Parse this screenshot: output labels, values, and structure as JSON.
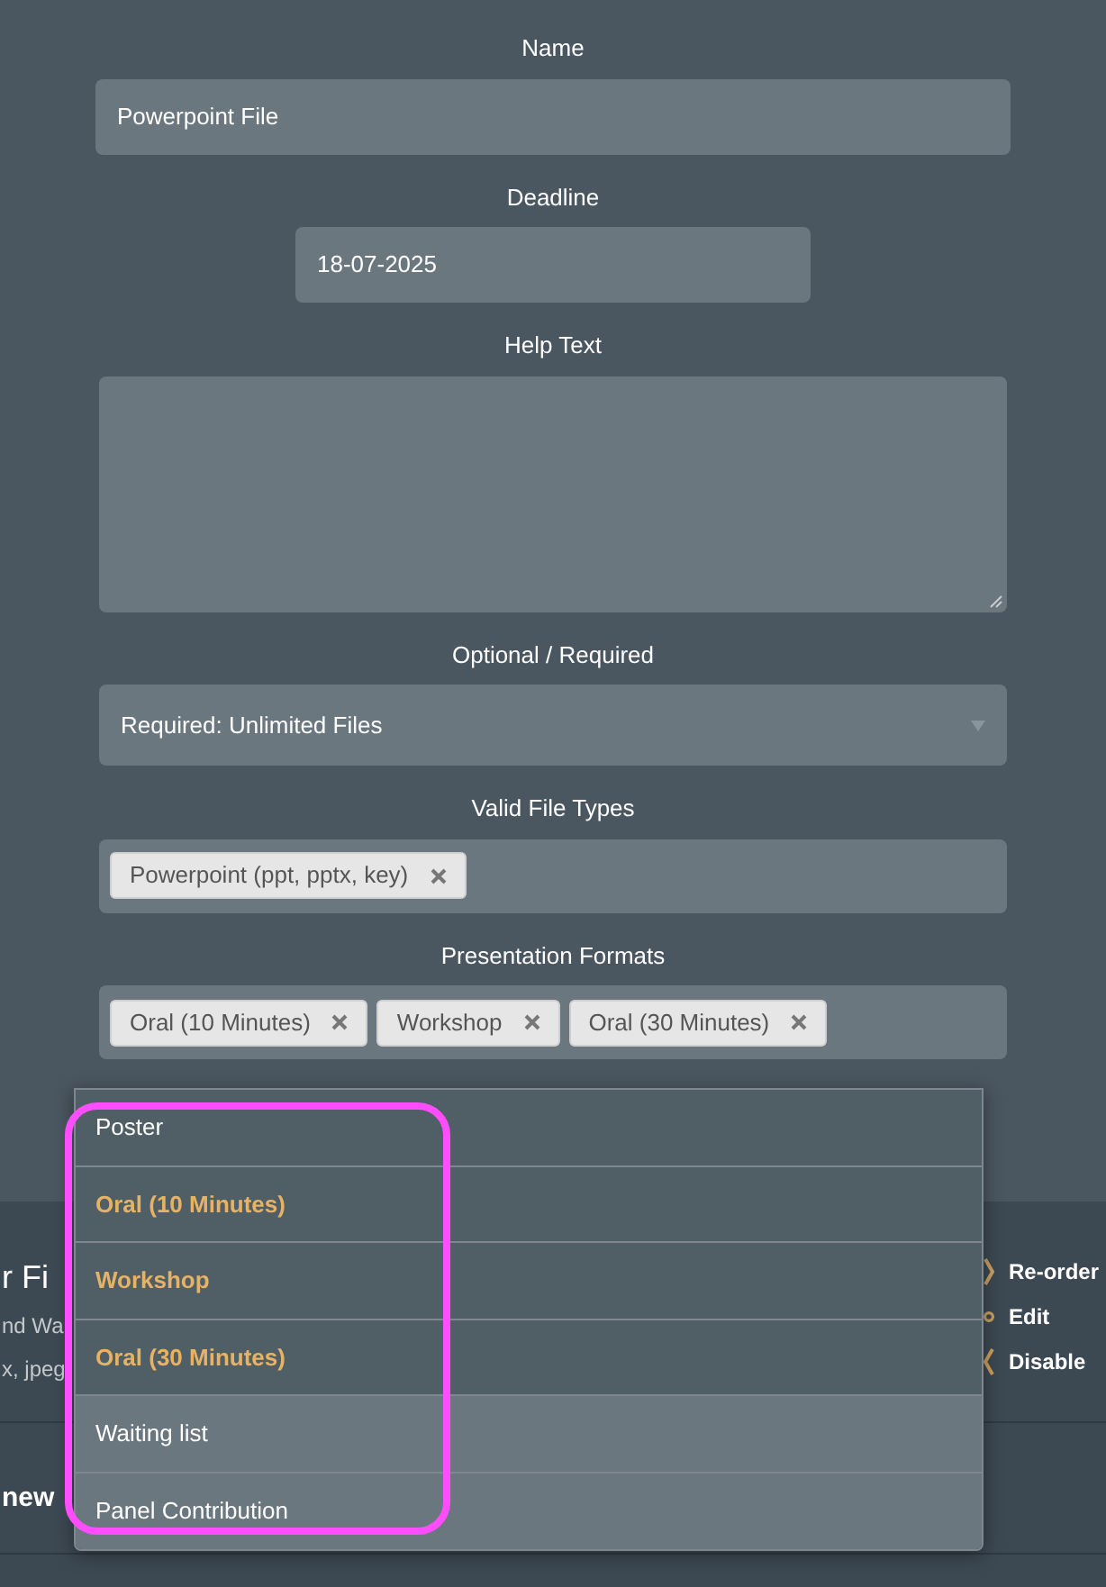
{
  "form": {
    "fields": [
      {
        "kind": "text",
        "label": "Name",
        "value": "Powerpoint File"
      },
      {
        "kind": "date",
        "label": "Deadline",
        "value": "18-07-2025"
      },
      {
        "kind": "textarea",
        "label": "Help Text"
      },
      {
        "kind": "select",
        "label": "Optional / Required",
        "value": "Required: Unlimited Files"
      },
      {
        "kind": "tags",
        "label": "Valid File Types",
        "tags": [
          "Powerpoint (ppt, pptx, key)"
        ]
      },
      {
        "kind": "tags",
        "label": "Presentation Formats",
        "tags": [
          "Oral (10 Minutes)",
          "Workshop",
          "Oral (30 Minutes)"
        ]
      }
    ]
  },
  "dropdown": {
    "options": [
      {
        "label": "Poster",
        "selected": false,
        "shaded": false
      },
      {
        "label": "Oral (10 Minutes)",
        "selected": true,
        "shaded": false
      },
      {
        "label": "Workshop",
        "selected": true,
        "shaded": false
      },
      {
        "label": "Oral (30 Minutes)",
        "selected": true,
        "shaded": false
      },
      {
        "label": "Waiting list",
        "selected": false,
        "shaded": true
      },
      {
        "label": "Panel Contribution",
        "selected": false,
        "shaded": true
      }
    ]
  },
  "background": {
    "title": "r Fi",
    "lines": [
      "nd Wa",
      "x, jpeg"
    ],
    "actions": [
      {
        "kind": "reorder",
        "label": "Re-order"
      },
      {
        "kind": "edit",
        "label": "Edit"
      },
      {
        "kind": "disable",
        "label": "Disable"
      }
    ],
    "next_title": "new"
  }
}
